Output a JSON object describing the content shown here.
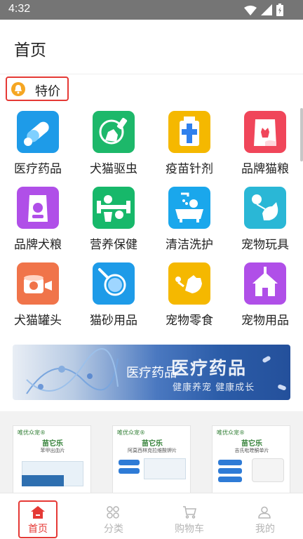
{
  "status_bar": {
    "time": "4:32",
    "icons": [
      "wifi-icon",
      "signal-icon",
      "battery-icon"
    ]
  },
  "header": {
    "title": "首页"
  },
  "special": {
    "label": "特价",
    "icon": "bell-icon"
  },
  "categories": [
    {
      "label": "医疗药品",
      "icon": "pill-capsule-icon",
      "color": "#1e9be8"
    },
    {
      "label": "犬猫驱虫",
      "icon": "deworm-dog-icon",
      "color": "#1db86a"
    },
    {
      "label": "疫苗针剂",
      "icon": "vaccine-cross-icon",
      "color": "#f5b800"
    },
    {
      "label": "品牌猫粮",
      "icon": "cat-food-bag-icon",
      "color": "#f0465a"
    },
    {
      "label": "品牌犬粮",
      "icon": "dog-food-bag-icon",
      "color": "#b04fe8"
    },
    {
      "label": "营养保健",
      "icon": "health-dogs-icon",
      "color": "#17b86a"
    },
    {
      "label": "清洁洗护",
      "icon": "dog-bath-icon",
      "color": "#1aa7ec"
    },
    {
      "label": "宠物玩具",
      "icon": "cat-toy-icon",
      "color": "#2ab7d6"
    },
    {
      "label": "犬猫罐头",
      "icon": "pet-can-icon",
      "color": "#f0744a"
    },
    {
      "label": "猫砂用品",
      "icon": "litter-scoop-icon",
      "color": "#1e9be8"
    },
    {
      "label": "宠物零食",
      "icon": "pet-snack-icon",
      "color": "#f5b800"
    },
    {
      "label": "宠物用品",
      "icon": "pet-house-icon",
      "color": "#b04fe8"
    }
  ],
  "banner": {
    "overlay_text": "医疗药品",
    "title": "医疗药品",
    "slogan": "健康养宠 健康成长"
  },
  "products": [
    {
      "brand": "唯优众宠®",
      "title": "苗它乐",
      "subtitle": "苯甲出血片"
    },
    {
      "brand": "唯优众宠®",
      "title": "苗它乐",
      "subtitle": "阿莫西林克拉维酸钾片"
    },
    {
      "brand": "唯优众宠®",
      "title": "苗它乐",
      "subtitle": "吉氏吡喹酮单片"
    }
  ],
  "tabbar": {
    "items": [
      {
        "label": "首页",
        "icon": "home-icon",
        "active": true
      },
      {
        "label": "分类",
        "icon": "category-grid-icon",
        "active": false
      },
      {
        "label": "购物车",
        "icon": "cart-icon",
        "active": false
      },
      {
        "label": "我的",
        "icon": "user-icon",
        "active": false
      }
    ],
    "active_color": "#e53935",
    "inactive_color": "#b5b5b5"
  }
}
